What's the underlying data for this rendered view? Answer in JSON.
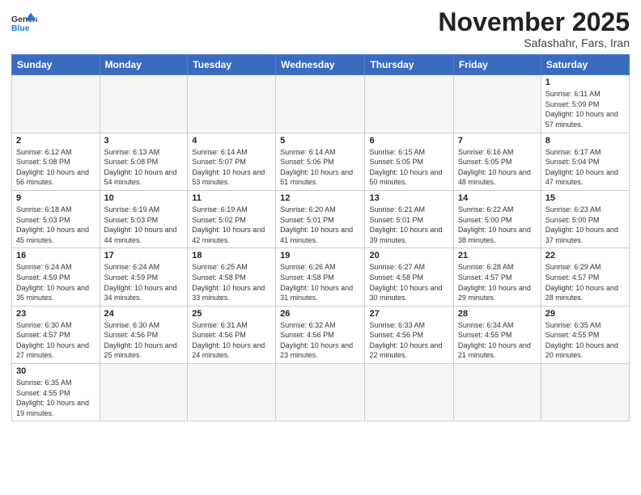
{
  "logo": {
    "line1": "General",
    "line2": "Blue"
  },
  "title": "November 2025",
  "subtitle": "Safashahr, Fars, Iran",
  "weekdays": [
    "Sunday",
    "Monday",
    "Tuesday",
    "Wednesday",
    "Thursday",
    "Friday",
    "Saturday"
  ],
  "weeks": [
    [
      {
        "day": "",
        "info": ""
      },
      {
        "day": "",
        "info": ""
      },
      {
        "day": "",
        "info": ""
      },
      {
        "day": "",
        "info": ""
      },
      {
        "day": "",
        "info": ""
      },
      {
        "day": "",
        "info": ""
      },
      {
        "day": "1",
        "info": "Sunrise: 6:11 AM\nSunset: 5:09 PM\nDaylight: 10 hours\nand 57 minutes."
      }
    ],
    [
      {
        "day": "2",
        "info": "Sunrise: 6:12 AM\nSunset: 5:08 PM\nDaylight: 10 hours\nand 56 minutes."
      },
      {
        "day": "3",
        "info": "Sunrise: 6:13 AM\nSunset: 5:08 PM\nDaylight: 10 hours\nand 54 minutes."
      },
      {
        "day": "4",
        "info": "Sunrise: 6:14 AM\nSunset: 5:07 PM\nDaylight: 10 hours\nand 53 minutes."
      },
      {
        "day": "5",
        "info": "Sunrise: 6:14 AM\nSunset: 5:06 PM\nDaylight: 10 hours\nand 51 minutes."
      },
      {
        "day": "6",
        "info": "Sunrise: 6:15 AM\nSunset: 5:05 PM\nDaylight: 10 hours\nand 50 minutes."
      },
      {
        "day": "7",
        "info": "Sunrise: 6:16 AM\nSunset: 5:05 PM\nDaylight: 10 hours\nand 48 minutes."
      },
      {
        "day": "8",
        "info": "Sunrise: 6:17 AM\nSunset: 5:04 PM\nDaylight: 10 hours\nand 47 minutes."
      }
    ],
    [
      {
        "day": "9",
        "info": "Sunrise: 6:18 AM\nSunset: 5:03 PM\nDaylight: 10 hours\nand 45 minutes."
      },
      {
        "day": "10",
        "info": "Sunrise: 6:19 AM\nSunset: 5:03 PM\nDaylight: 10 hours\nand 44 minutes."
      },
      {
        "day": "11",
        "info": "Sunrise: 6:19 AM\nSunset: 5:02 PM\nDaylight: 10 hours\nand 42 minutes."
      },
      {
        "day": "12",
        "info": "Sunrise: 6:20 AM\nSunset: 5:01 PM\nDaylight: 10 hours\nand 41 minutes."
      },
      {
        "day": "13",
        "info": "Sunrise: 6:21 AM\nSunset: 5:01 PM\nDaylight: 10 hours\nand 39 minutes."
      },
      {
        "day": "14",
        "info": "Sunrise: 6:22 AM\nSunset: 5:00 PM\nDaylight: 10 hours\nand 38 minutes."
      },
      {
        "day": "15",
        "info": "Sunrise: 6:23 AM\nSunset: 5:00 PM\nDaylight: 10 hours\nand 37 minutes."
      }
    ],
    [
      {
        "day": "16",
        "info": "Sunrise: 6:24 AM\nSunset: 4:59 PM\nDaylight: 10 hours\nand 35 minutes."
      },
      {
        "day": "17",
        "info": "Sunrise: 6:24 AM\nSunset: 4:59 PM\nDaylight: 10 hours\nand 34 minutes."
      },
      {
        "day": "18",
        "info": "Sunrise: 6:25 AM\nSunset: 4:58 PM\nDaylight: 10 hours\nand 33 minutes."
      },
      {
        "day": "19",
        "info": "Sunrise: 6:26 AM\nSunset: 4:58 PM\nDaylight: 10 hours\nand 31 minutes."
      },
      {
        "day": "20",
        "info": "Sunrise: 6:27 AM\nSunset: 4:58 PM\nDaylight: 10 hours\nand 30 minutes."
      },
      {
        "day": "21",
        "info": "Sunrise: 6:28 AM\nSunset: 4:57 PM\nDaylight: 10 hours\nand 29 minutes."
      },
      {
        "day": "22",
        "info": "Sunrise: 6:29 AM\nSunset: 4:57 PM\nDaylight: 10 hours\nand 28 minutes."
      }
    ],
    [
      {
        "day": "23",
        "info": "Sunrise: 6:30 AM\nSunset: 4:57 PM\nDaylight: 10 hours\nand 27 minutes."
      },
      {
        "day": "24",
        "info": "Sunrise: 6:30 AM\nSunset: 4:56 PM\nDaylight: 10 hours\nand 25 minutes."
      },
      {
        "day": "25",
        "info": "Sunrise: 6:31 AM\nSunset: 4:56 PM\nDaylight: 10 hours\nand 24 minutes."
      },
      {
        "day": "26",
        "info": "Sunrise: 6:32 AM\nSunset: 4:56 PM\nDaylight: 10 hours\nand 23 minutes."
      },
      {
        "day": "27",
        "info": "Sunrise: 6:33 AM\nSunset: 4:56 PM\nDaylight: 10 hours\nand 22 minutes."
      },
      {
        "day": "28",
        "info": "Sunrise: 6:34 AM\nSunset: 4:55 PM\nDaylight: 10 hours\nand 21 minutes."
      },
      {
        "day": "29",
        "info": "Sunrise: 6:35 AM\nSunset: 4:55 PM\nDaylight: 10 hours\nand 20 minutes."
      }
    ],
    [
      {
        "day": "30",
        "info": "Sunrise: 6:35 AM\nSunset: 4:55 PM\nDaylight: 10 hours\nand 19 minutes."
      },
      {
        "day": "",
        "info": ""
      },
      {
        "day": "",
        "info": ""
      },
      {
        "day": "",
        "info": ""
      },
      {
        "day": "",
        "info": ""
      },
      {
        "day": "",
        "info": ""
      },
      {
        "day": "",
        "info": ""
      }
    ]
  ]
}
